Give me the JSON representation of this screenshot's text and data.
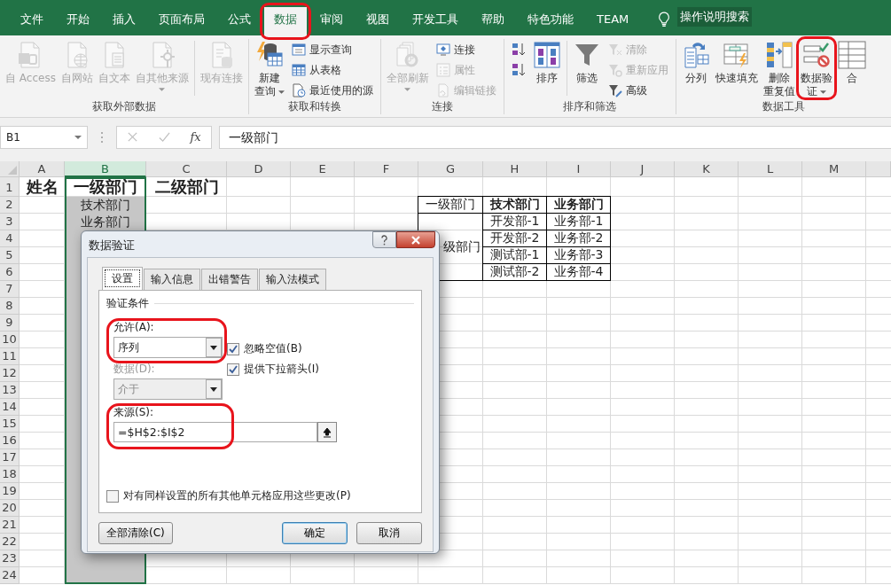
{
  "tabs": [
    {
      "label": "文件",
      "selected": false,
      "circled": false
    },
    {
      "label": "开始",
      "selected": false,
      "circled": false
    },
    {
      "label": "插入",
      "selected": false,
      "circled": false
    },
    {
      "label": "页面布局",
      "selected": false,
      "circled": false
    },
    {
      "label": "公式",
      "selected": false,
      "circled": false
    },
    {
      "label": "数据",
      "selected": true,
      "circled": true
    },
    {
      "label": "审阅",
      "selected": false,
      "circled": false
    },
    {
      "label": "视图",
      "selected": false,
      "circled": false
    },
    {
      "label": "开发工具",
      "selected": false,
      "circled": false
    },
    {
      "label": "帮助",
      "selected": false,
      "circled": false
    },
    {
      "label": "特色功能",
      "selected": false,
      "circled": false
    },
    {
      "label": "TEAM",
      "selected": false,
      "circled": false
    }
  ],
  "tell_me": "操作说明搜索",
  "ribbon": {
    "groups": [
      {
        "label": "获取外部数据",
        "items": [
          {
            "kind": "large",
            "lines": [
              "自 Access"
            ],
            "disabled": true,
            "dropdown": false
          },
          {
            "kind": "large",
            "lines": [
              "自网站"
            ],
            "disabled": true,
            "dropdown": false
          },
          {
            "kind": "large",
            "lines": [
              "自文本"
            ],
            "disabled": true,
            "dropdown": false
          },
          {
            "kind": "large",
            "lines": [
              "自其他来源"
            ],
            "disabled": true,
            "dropdown": true
          },
          {
            "kind": "separator"
          },
          {
            "kind": "large",
            "lines": [
              "现有连接"
            ],
            "disabled": true,
            "dropdown": false
          }
        ]
      },
      {
        "label": "获取和转换",
        "items": [
          {
            "kind": "large",
            "lines": [
              "新建",
              "查询"
            ],
            "disabled": false,
            "dropdown": true
          },
          {
            "kind": "stack",
            "items": [
              {
                "label": "显示查询",
                "disabled": false
              },
              {
                "label": "从表格",
                "disabled": false
              },
              {
                "label": "最近使用的源",
                "disabled": false
              }
            ]
          }
        ]
      },
      {
        "label": "连接",
        "items": [
          {
            "kind": "large",
            "lines": [
              "全部刷新"
            ],
            "disabled": true,
            "dropdown": true
          },
          {
            "kind": "stack",
            "items": [
              {
                "label": "连接",
                "disabled": false
              },
              {
                "label": "属性",
                "disabled": true
              },
              {
                "label": "编辑链接",
                "disabled": true
              }
            ]
          }
        ]
      },
      {
        "label": "排序和筛选",
        "items": [
          {
            "kind": "stack",
            "items": [
              {
                "disabled": false
              },
              {
                "disabled": false
              }
            ]
          },
          {
            "kind": "large",
            "lines": [
              "排序"
            ],
            "disabled": false,
            "dropdown": false
          },
          {
            "kind": "separator"
          },
          {
            "kind": "large",
            "lines": [
              "筛选"
            ],
            "disabled": false,
            "dropdown": false
          },
          {
            "kind": "stack",
            "items": [
              {
                "label": "清除",
                "disabled": true
              },
              {
                "label": "重新应用",
                "disabled": true
              },
              {
                "label": "高级",
                "disabled": false
              }
            ]
          }
        ]
      },
      {
        "label": "数据工具",
        "items": [
          {
            "kind": "large",
            "lines": [
              "分列"
            ],
            "disabled": false,
            "dropdown": false
          },
          {
            "kind": "large",
            "lines": [
              "快速填充"
            ],
            "disabled": false,
            "dropdown": false
          },
          {
            "kind": "large",
            "lines": [
              "删除",
              "重复值"
            ],
            "disabled": false,
            "dropdown": false
          },
          {
            "kind": "large",
            "lines": [
              "数据验",
              "证"
            ],
            "disabled": false,
            "dropdown": true,
            "circled": true
          },
          {
            "kind": "large",
            "lines": [
              "合"
            ],
            "disabled": false,
            "dropdown": false
          }
        ]
      }
    ]
  },
  "formula_bar": {
    "name_box": "B1",
    "function_label": "fx",
    "value": "一级部门"
  },
  "sheet": {
    "columns": [
      {
        "label": "A",
        "selected": false
      },
      {
        "label": "B",
        "selected": true
      },
      {
        "label": "C",
        "selected": false
      },
      {
        "label": "D",
        "selected": false
      },
      {
        "label": "E",
        "selected": false
      },
      {
        "label": "F",
        "selected": false
      },
      {
        "label": "G",
        "selected": false
      },
      {
        "label": "H",
        "selected": false
      },
      {
        "label": "I",
        "selected": false
      },
      {
        "label": "J",
        "selected": false
      },
      {
        "label": "K",
        "selected": false
      },
      {
        "label": "L",
        "selected": false
      },
      {
        "label": "M",
        "selected": false
      }
    ],
    "rows": [
      {
        "label": "1",
        "cells": {
          "A": {
            "text": "姓名",
            "bold": true,
            "bordered": false
          },
          "B": {
            "text": "一级部门",
            "bold": true,
            "bordered": false
          },
          "C": {
            "text": "二级部门",
            "bold": true,
            "bordered": false
          }
        }
      },
      {
        "label": "2",
        "cells": {
          "B": {
            "text": "技术部门",
            "bold": false,
            "bordered": false
          },
          "G": {
            "text": "一级部门",
            "bold": false,
            "bordered": true
          },
          "H": {
            "text": "技术部门",
            "bold": true,
            "bordered": true
          },
          "I": {
            "text": "业务部门",
            "bold": true,
            "bordered": true
          }
        }
      },
      {
        "label": "3",
        "cells": {
          "B": {
            "text": "业务部门",
            "bold": false,
            "bordered": false
          },
          "G": {
            "text": "级部门",
            "bold": false,
            "bordered": true,
            "merged": true
          },
          "H": {
            "text": "开发部-1",
            "bold": false,
            "bordered": true
          },
          "I": {
            "text": "业务部-1",
            "bold": false,
            "bordered": true
          }
        }
      },
      {
        "label": "4",
        "cells": {
          "H": {
            "text": "开发部-2",
            "bold": false,
            "bordered": true
          },
          "I": {
            "text": "业务部-2",
            "bold": false,
            "bordered": true
          }
        }
      },
      {
        "label": "5",
        "cells": {
          "H": {
            "text": "测试部-1",
            "bold": false,
            "bordered": true
          },
          "I": {
            "text": "业务部-3",
            "bold": false,
            "bordered": true
          }
        }
      },
      {
        "label": "6",
        "cells": {
          "H": {
            "text": "测试部-2",
            "bold": false,
            "bordered": true
          },
          "I": {
            "text": "业务部-4",
            "bold": false,
            "bordered": true
          }
        }
      },
      {
        "label": "7"
      },
      {
        "label": "8"
      },
      {
        "label": "9"
      },
      {
        "label": "10"
      },
      {
        "label": "11"
      },
      {
        "label": "12"
      },
      {
        "label": "13"
      },
      {
        "label": "14"
      },
      {
        "label": "15"
      },
      {
        "label": "16"
      },
      {
        "label": "17"
      },
      {
        "label": "18"
      },
      {
        "label": "19"
      },
      {
        "label": "20"
      },
      {
        "label": "21"
      },
      {
        "label": "22"
      },
      {
        "label": "23"
      },
      {
        "label": "24"
      }
    ]
  },
  "dialog": {
    "title": "数据验证",
    "tabs": [
      {
        "label": "设置",
        "selected": true
      },
      {
        "label": "输入信息",
        "selected": false
      },
      {
        "label": "出错警告",
        "selected": false
      },
      {
        "label": "输入法模式",
        "selected": false
      }
    ],
    "section": "验证条件",
    "allow": {
      "label": "允许(A):",
      "value": "序列",
      "circled": true
    },
    "options": [
      {
        "label": "忽略空值(B)",
        "checked": true
      },
      {
        "label": "提供下拉箭头(I)",
        "checked": true
      }
    ],
    "data": {
      "label": "数据(D):",
      "value": "介于",
      "disabled": true
    },
    "source": {
      "label": "来源(S):",
      "value": "=$H$2:$I$2",
      "circled": true
    },
    "apply_all": {
      "label": "对有同样设置的所有其他单元格应用这些更改(P)",
      "checked": false
    },
    "buttons": [
      {
        "label": "全部清除(C)",
        "kind": "clear"
      },
      {
        "label": "确定",
        "kind": "default"
      },
      {
        "label": "取消",
        "kind": "cancel"
      }
    ]
  }
}
